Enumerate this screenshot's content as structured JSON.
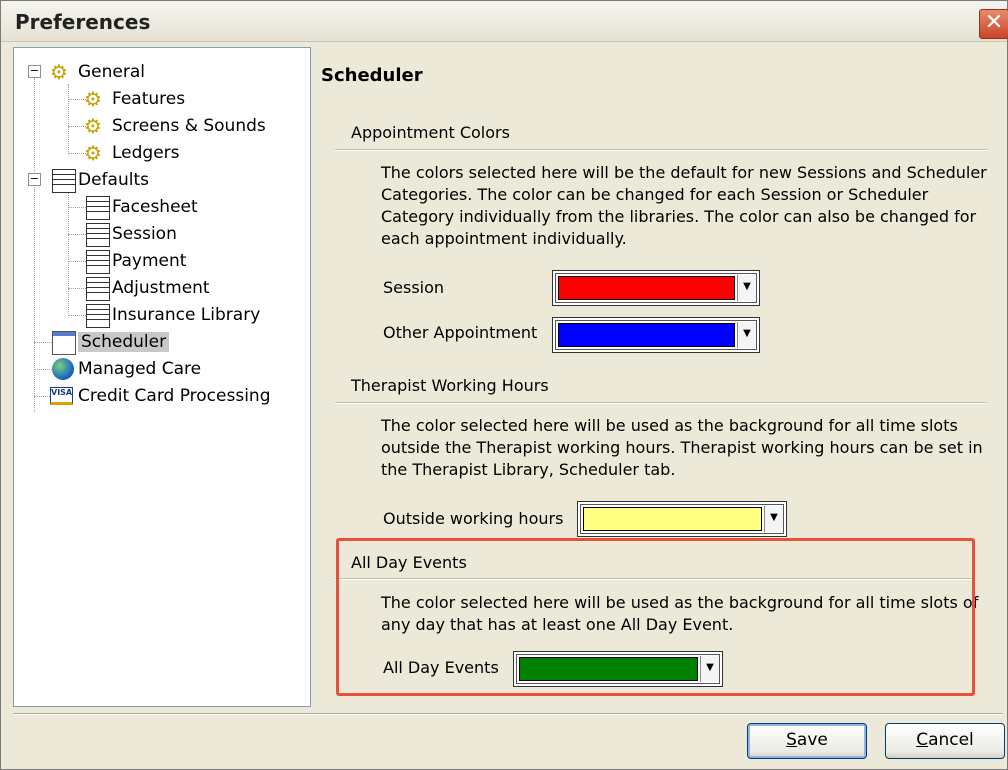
{
  "window": {
    "title": "Preferences",
    "close_glyph": "✕"
  },
  "tree": {
    "general": "General",
    "features": "Features",
    "screens_sounds": "Screens & Sounds",
    "ledgers": "Ledgers",
    "defaults": "Defaults",
    "facesheet": "Facesheet",
    "session": "Session",
    "payment": "Payment",
    "adjustment": "Adjustment",
    "insurance_library": "Insurance Library",
    "scheduler": "Scheduler",
    "managed_care": "Managed Care",
    "credit_card": "Credit Card Processing",
    "visa_text": "VISA",
    "expand_glyph": "−"
  },
  "main": {
    "title": "Scheduler",
    "appointment_colors": {
      "header": "Appointment Colors",
      "description": "The colors selected here will be the default for new Sessions and Scheduler Categories. The color can be changed for each Session or Scheduler Category individually from the libraries.  The color can also be changed for each appointment individually.",
      "session_label": "Session",
      "session_color": "#ff0000",
      "other_label": "Other Appointment",
      "other_color": "#0000ff"
    },
    "working_hours": {
      "header": "Therapist Working Hours",
      "description": "The color selected here will be used as the background for all time slots outside the Therapist working hours.  Therapist working hours can be set in the Therapist Library, Scheduler tab.",
      "outside_label": "Outside working hours",
      "outside_color": "#ffff80"
    },
    "all_day": {
      "header": "All Day Events",
      "description": "The color selected here will be used as the background for all time slots of any day that has at least one All Day Event.",
      "label": "All Day Events",
      "color": "#008000"
    },
    "highlight_color": "#e8503c"
  },
  "buttons": {
    "save_underlined": "S",
    "save_rest": "ave",
    "cancel_underlined": "C",
    "cancel_rest": "ancel"
  },
  "icons": {
    "dropdown": "▼",
    "gear": "⚙"
  }
}
